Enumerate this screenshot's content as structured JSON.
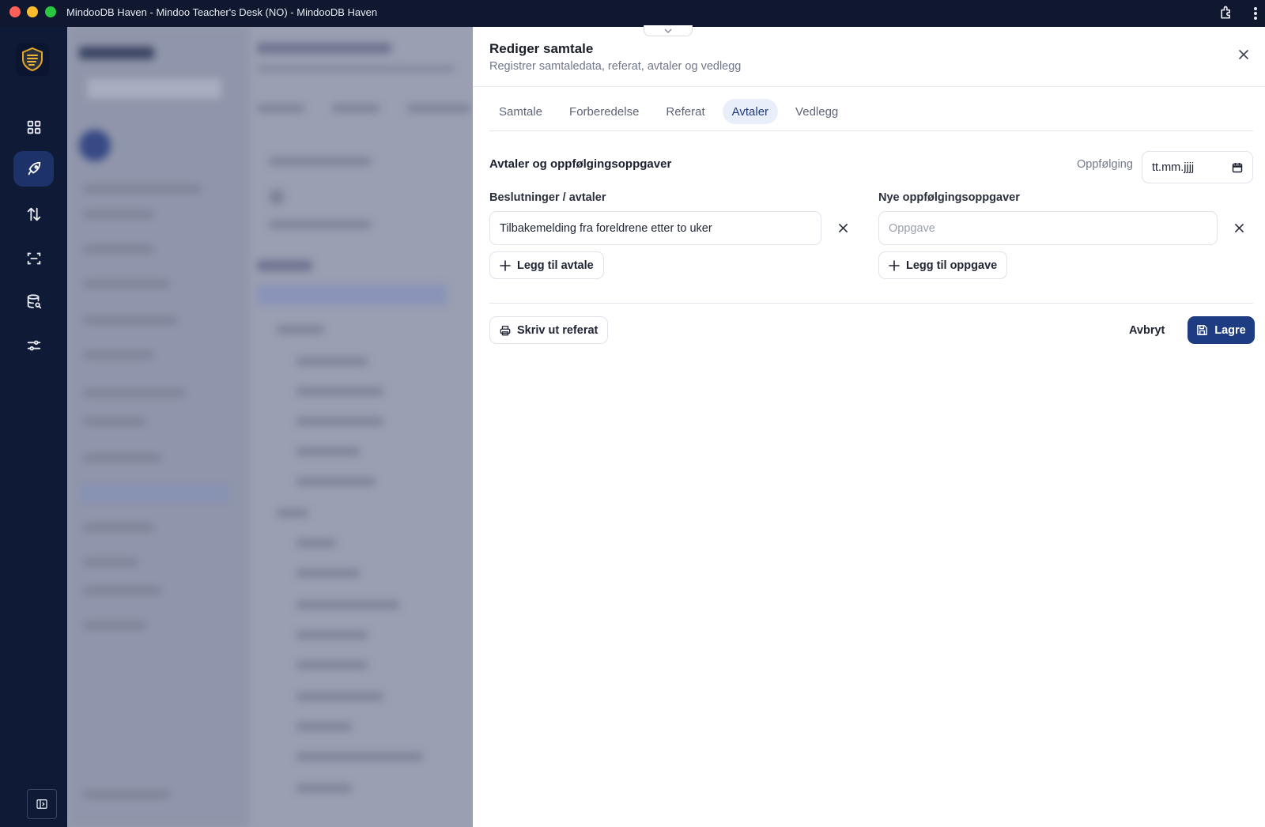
{
  "window": {
    "title": "MindooDB Haven - Mindoo Teacher's Desk (NO) - MindooDB Haven"
  },
  "rail": {
    "items": [
      {
        "icon": "dashboard-icon",
        "active": false
      },
      {
        "icon": "rocket-icon",
        "active": true
      },
      {
        "icon": "sync-arrows-icon",
        "active": false
      },
      {
        "icon": "scan-icon",
        "active": false
      },
      {
        "icon": "database-search-icon",
        "active": false
      },
      {
        "icon": "sliders-icon",
        "active": false
      }
    ]
  },
  "dialog": {
    "title": "Rediger samtale",
    "subtitle": "Registrer samtaledata, referat, avtaler og vedlegg",
    "tabs": [
      {
        "label": "Samtale",
        "active": false
      },
      {
        "label": "Forberedelse",
        "active": false
      },
      {
        "label": "Referat",
        "active": false
      },
      {
        "label": "Avtaler",
        "active": true
      },
      {
        "label": "Vedlegg",
        "active": false
      }
    ],
    "section_title": "Avtaler og oppfølgingsoppgaver",
    "followup_label": "Oppfølging",
    "followup_placeholder": "tt.mm.jjjj",
    "decisions": {
      "label": "Beslutninger / avtaler",
      "items": [
        "Tilbakemelding fra foreldrene etter to uker"
      ],
      "add_label": "Legg til avtale"
    },
    "tasks": {
      "label": "Nye oppfølgingsoppgaver",
      "placeholder": "Oppgave",
      "add_label": "Legg til oppgave"
    },
    "print_label": "Skriv ut referat",
    "cancel_label": "Avbryt",
    "save_label": "Lagre"
  },
  "colors": {
    "primary": "#1e3c82",
    "rail": "#0f1a37",
    "active_tab_bg": "#e9eefb"
  }
}
